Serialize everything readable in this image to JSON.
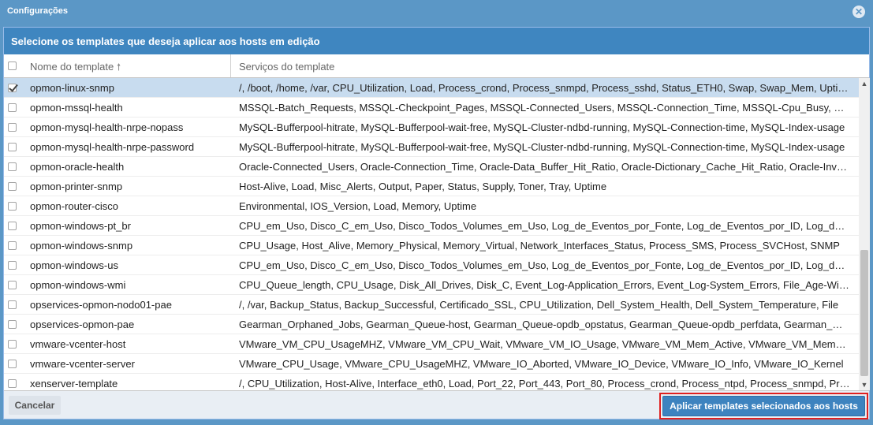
{
  "window": {
    "title": "Configurações"
  },
  "header": {
    "text": "Selecione os templates que deseja aplicar aos hosts em edição"
  },
  "columns": {
    "name": "Nome do template",
    "services": "Serviços do template"
  },
  "rows": [
    {
      "name": "opmon-linux-snmp",
      "services": "/, /boot, /home, /var, CPU_Utilization, Load, Process_crond, Process_snmpd, Process_sshd, Status_ETH0, Swap, Swap_Mem, Uptime",
      "checked": true
    },
    {
      "name": "opmon-mssql-health",
      "services": "MSSQL-Batch_Requests, MSSQL-Checkpoint_Pages, MSSQL-Connected_Users, MSSQL-Connection_Time, MSSQL-Cpu_Busy, MSSQL",
      "checked": false
    },
    {
      "name": "opmon-mysql-health-nrpe-nopass",
      "services": "MySQL-Bufferpool-hitrate, MySQL-Bufferpool-wait-free, MySQL-Cluster-ndbd-running, MySQL-Connection-time, MySQL-Index-usage",
      "checked": false
    },
    {
      "name": "opmon-mysql-health-nrpe-password",
      "services": "MySQL-Bufferpool-hitrate, MySQL-Bufferpool-wait-free, MySQL-Cluster-ndbd-running, MySQL-Connection-time, MySQL-Index-usage",
      "checked": false
    },
    {
      "name": "opmon-oracle-health",
      "services": "Oracle-Connected_Users, Oracle-Connection_Time, Oracle-Data_Buffer_Hit_Ratio, Oracle-Dictionary_Cache_Hit_Ratio, Oracle-Invalid",
      "checked": false
    },
    {
      "name": "opmon-printer-snmp",
      "services": "Host-Alive, Load, Misc_Alerts, Output, Paper, Status, Supply, Toner, Tray, Uptime",
      "checked": false
    },
    {
      "name": "opmon-router-cisco",
      "services": "Environmental, IOS_Version, Load, Memory, Uptime",
      "checked": false
    },
    {
      "name": "opmon-windows-pt_br",
      "services": "CPU_em_Uso, Disco_C_em_Uso, Disco_Todos_Volumes_em_Uso, Log_de_Eventos_por_Fonte, Log_de_Eventos_por_ID, Log_de_Eventos",
      "checked": false
    },
    {
      "name": "opmon-windows-snmp",
      "services": "CPU_Usage, Host_Alive, Memory_Physical, Memory_Virtual, Network_Interfaces_Status, Process_SMS, Process_SVCHost, SNMP",
      "checked": false
    },
    {
      "name": "opmon-windows-us",
      "services": "CPU_em_Uso, Disco_C_em_Uso, Disco_Todos_Volumes_em_Uso, Log_de_Eventos_por_Fonte, Log_de_Eventos_por_ID, Log_de_Eventos",
      "checked": false
    },
    {
      "name": "opmon-windows-wmi",
      "services": "CPU_Queue_length, CPU_Usage, Disk_All_Drives, Disk_C, Event_Log-Application_Errors, Event_Log-System_Errors, File_Age-Windows",
      "checked": false
    },
    {
      "name": "opservices-opmon-nodo01-pae",
      "services": "/, /var, Backup_Status, Backup_Successful, Certificado_SSL, CPU_Utilization, Dell_System_Health, Dell_System_Temperature, File",
      "checked": false
    },
    {
      "name": "opservices-opmon-pae",
      "services": "Gearman_Orphaned_Jobs, Gearman_Queue-host, Gearman_Queue-opdb_opstatus, Gearman_Queue-opdb_perfdata, Gearman_Queue",
      "checked": false
    },
    {
      "name": "vmware-vcenter-host",
      "services": "VMware_VM_CPU_UsageMHZ, VMware_VM_CPU_Wait, VMware_VM_IO_Usage, VMware_VM_Mem_Active, VMware_VM_Mem_Usage",
      "checked": false
    },
    {
      "name": "vmware-vcenter-server",
      "services": "VMware_CPU_Usage, VMware_CPU_UsageMHZ, VMware_IO_Aborted, VMware_IO_Device, VMware_IO_Info, VMware_IO_Kernel",
      "checked": false
    },
    {
      "name": "xenserver-template",
      "services": "/, CPU_Utilization, Host-Alive, Interface_eth0, Load, Port_22, Port_443, Port_80, Process_crond, Process_ntpd, Process_snmpd, Process",
      "checked": false
    }
  ],
  "footer": {
    "cancel_label": "Cancelar",
    "apply_label": "Aplicar templates selecionados aos hosts"
  }
}
